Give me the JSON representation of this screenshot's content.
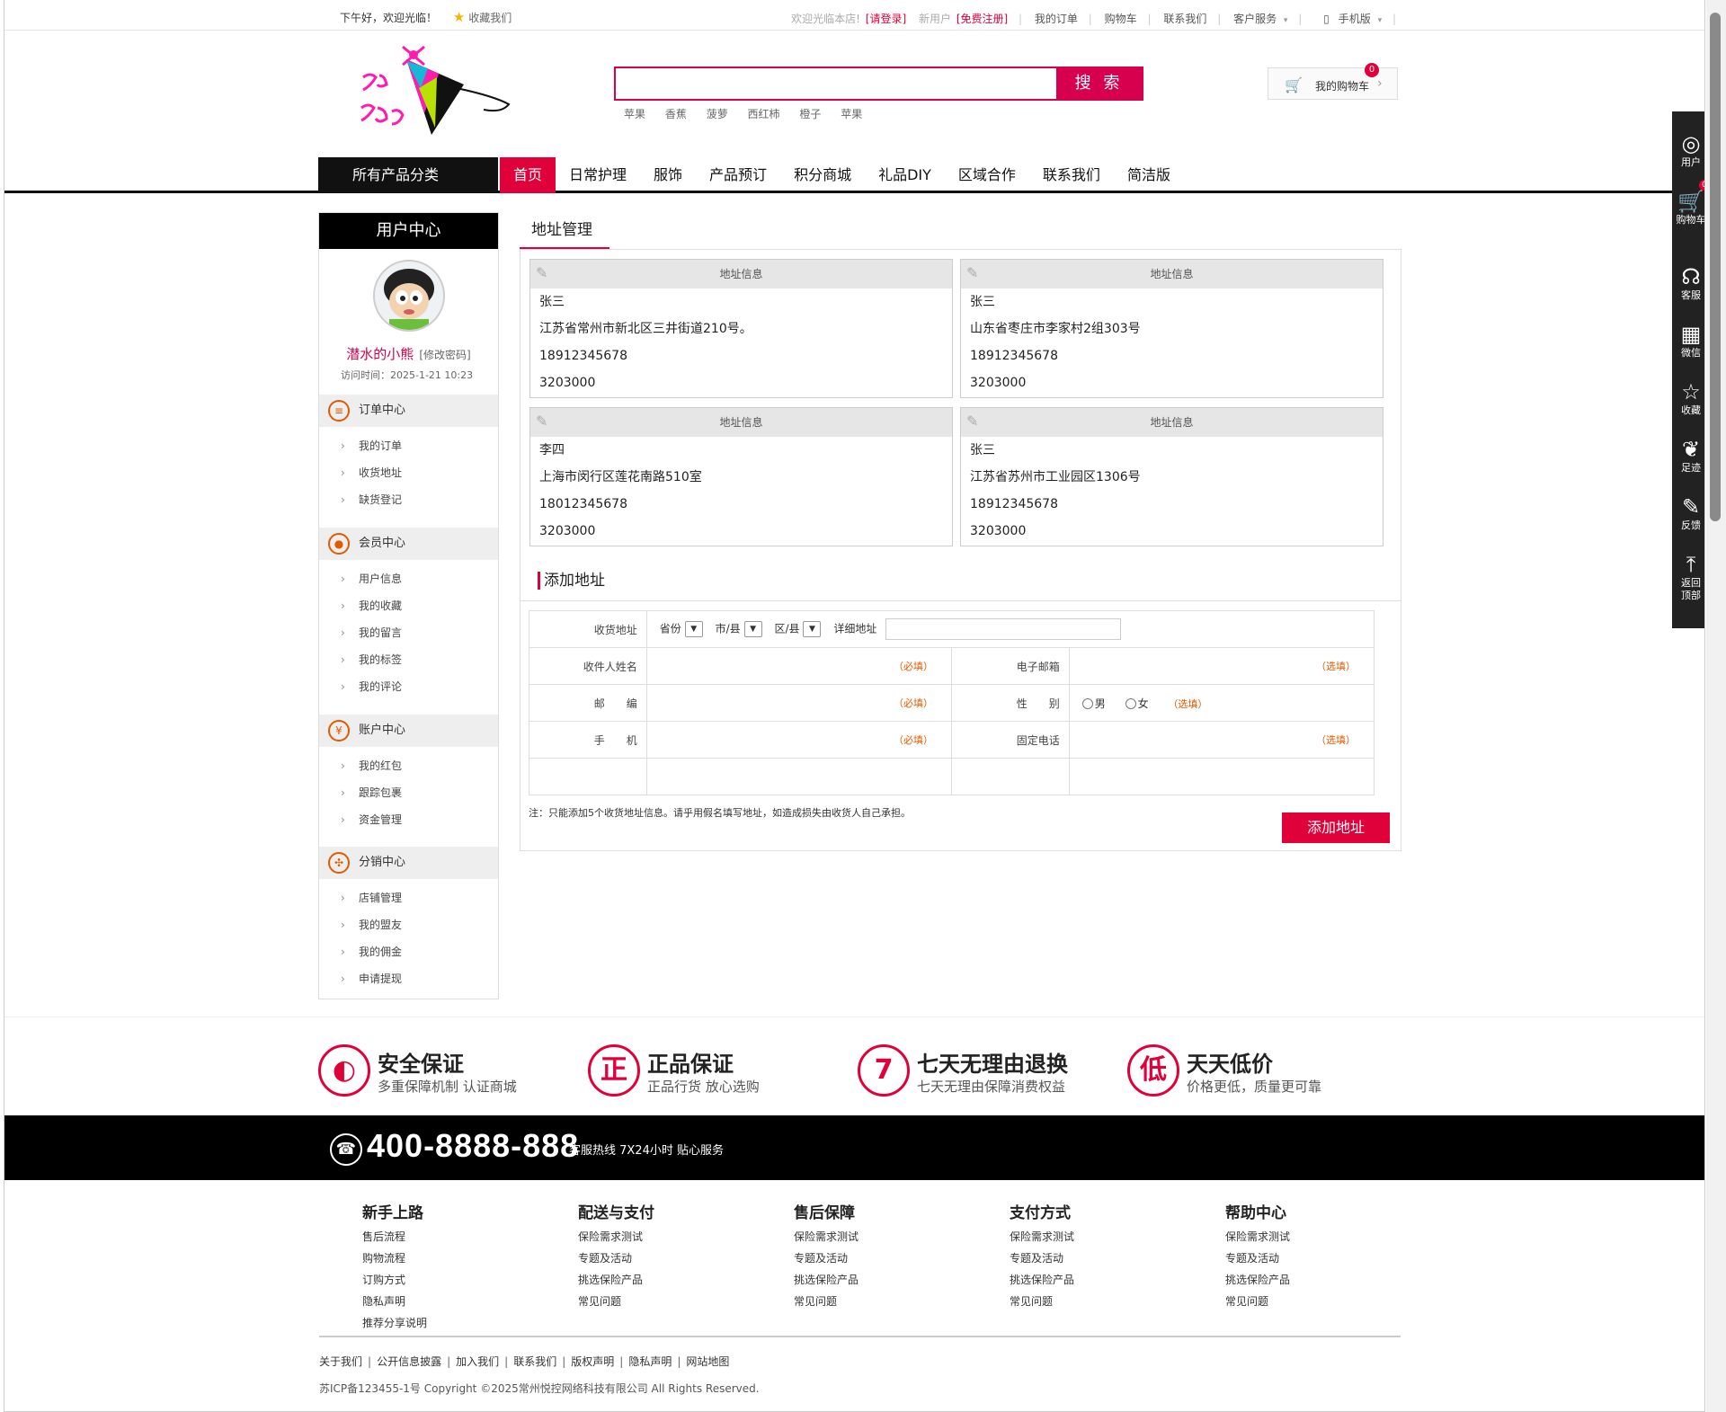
{
  "topbar": {
    "greeting": "下午好，欢迎光临！",
    "favorite": "收藏我们",
    "welcome": "欢迎光临本店!",
    "login": "[请登录]",
    "new_user": "新用户",
    "register": "[免费注册]",
    "my_orders": "我的订单",
    "cart": "购物车",
    "contact": "联系我们",
    "service": "客户服务",
    "mobile": "手机版"
  },
  "search": {
    "button": "搜 索",
    "placeholder": "",
    "hot_words": [
      "苹果",
      "香蕉",
      "菠萝",
      "西红柿",
      "橙子",
      "苹果"
    ]
  },
  "header_cart": {
    "label": "我的购物车",
    "count": "0"
  },
  "nav": {
    "all_categories": "所有产品分类",
    "items": [
      "首页",
      "日常护理",
      "服饰",
      "产品预订",
      "积分商城",
      "礼品DIY",
      "区域合作",
      "联系我们",
      "简洁版"
    ]
  },
  "sidebar": {
    "title": "用户中心",
    "username": "潜水的小熊",
    "change_password": "[修改密码]",
    "visit_time": "访问时间：2025-1-21 10:23",
    "groups": [
      {
        "title": "订单中心",
        "icon": "≡",
        "items": [
          "我的订单",
          "收货地址",
          "缺货登记"
        ]
      },
      {
        "title": "会员中心",
        "icon": "●",
        "items": [
          "用户信息",
          "我的收藏",
          "我的留言",
          "我的标签",
          "我的评论"
        ]
      },
      {
        "title": "账户中心",
        "icon": "¥",
        "items": [
          "我的红包",
          "跟踪包裹",
          "资金管理"
        ]
      },
      {
        "title": "分销中心",
        "icon": "✣",
        "items": [
          "店铺管理",
          "我的盟友",
          "我的佣金",
          "申请提现"
        ]
      }
    ]
  },
  "main": {
    "title": "地址管理",
    "card_header": "地址信息",
    "addresses": [
      {
        "name": "张三",
        "address": "江苏省常州市新北区三井街道210号。",
        "phone": "18912345678",
        "zip": "3203000"
      },
      {
        "name": "张三",
        "address": "山东省枣庄市李家村2组303号",
        "phone": "18912345678",
        "zip": "3203000"
      },
      {
        "name": "李四",
        "address": "上海市闵行区莲花南路510室",
        "phone": "18012345678",
        "zip": "3203000"
      },
      {
        "name": "张三",
        "address": "江苏省苏州市工业园区1306号",
        "phone": "18912345678",
        "zip": "3203000"
      }
    ],
    "add_title": "添加地址",
    "form": {
      "ship_address": "收货地址",
      "province": "省份",
      "city": "市/县",
      "district": "区/县",
      "detail": "详细地址",
      "receiver": "收件人姓名",
      "email": "电子邮箱",
      "zip": "邮　　编",
      "gender": "性　　别",
      "male": "男",
      "female": "女",
      "mobile": "手　　机",
      "tel": "固定电话",
      "required": "（必填）",
      "optional": "（选填）"
    },
    "note": "注：只能添加5个收货地址信息。请乎用假名填写地址，如造成损失由收货人自己承担。",
    "add_button": "添加地址"
  },
  "dock": {
    "items": [
      "用户",
      "购物车",
      "客服",
      "微信",
      "收藏",
      "足迹",
      "反馈",
      "返回顶部"
    ],
    "cart_badge": "0"
  },
  "features": [
    {
      "icon": "◐",
      "title": "安全保证",
      "sub": "多重保障机制 认证商城"
    },
    {
      "icon": "正",
      "title": "正品保证",
      "sub": "正品行货 放心选购"
    },
    {
      "icon": "7",
      "title": "七天无理由退换",
      "sub": "七天无理由保障消费权益"
    },
    {
      "icon": "低",
      "title": "天天低价",
      "sub": "价格更低，质量更可靠"
    }
  ],
  "hotline": {
    "number": "400-8888-888",
    "service": "客服热线 7X24小时 贴心服务"
  },
  "footer": {
    "columns": [
      {
        "title": "新手上路",
        "links": [
          "售后流程",
          "购物流程",
          "订购方式",
          "隐私声明",
          "推荐分享说明"
        ]
      },
      {
        "title": "配送与支付",
        "links": [
          "保险需求测试",
          "专题及活动",
          "挑选保险产品",
          "常见问题"
        ]
      },
      {
        "title": "售后保障",
        "links": [
          "保险需求测试",
          "专题及活动",
          "挑选保险产品",
          "常见问题"
        ]
      },
      {
        "title": "支付方式",
        "links": [
          "保险需求测试",
          "专题及活动",
          "挑选保险产品",
          "常见问题"
        ]
      },
      {
        "title": "帮助中心",
        "links": [
          "保险需求测试",
          "专题及活动",
          "挑选保险产品",
          "常见问题"
        ]
      }
    ],
    "links": [
      "关于我们",
      "公开信息披露",
      "加入我们",
      "联系我们",
      "版权声明",
      "隐私声明",
      "网站地图"
    ],
    "copyright": "苏ICP备123455-1号 Copyright ©2025常州悦控网络科技有限公司 All Rights Reserved."
  },
  "colors": {
    "accent": "#e0003a",
    "brand": "#d6004e",
    "nav_dark": "#111111"
  }
}
